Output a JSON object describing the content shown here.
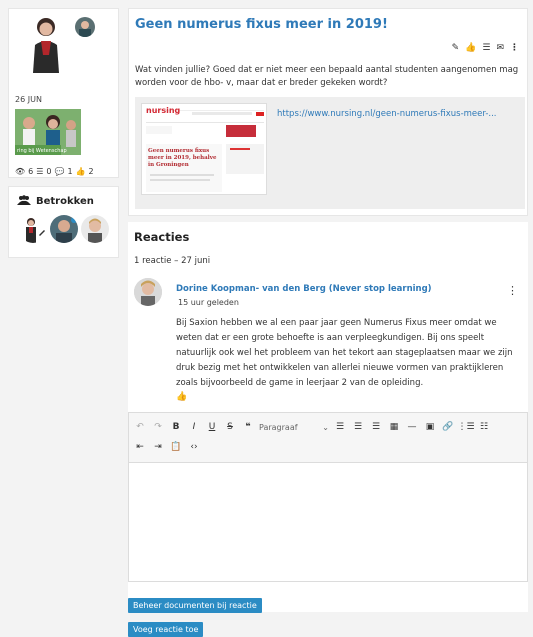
{
  "sidebar": {
    "date": "26 JUN",
    "thumb_caption": "ring bij Wetenschap",
    "stats": {
      "views": "6",
      "list": "0",
      "comments": "1",
      "likes": "2"
    },
    "involved_title": "Betrokken"
  },
  "post": {
    "title": "Geen numerus fixus meer in 2019!",
    "text": "Wat vinden jullie? Goed dat er niet meer een bepaald aantal studenten aangenomen mag worden voor de hbo- v, maar dat er breder gekeken wordt?",
    "link_url": "https://www.nursing.nl/geen-numerus-fixus-meer-...",
    "preview": {
      "brand": "nursing",
      "headline": "Geen numerus fixus meer in 2019, behalve in Groningen"
    }
  },
  "comments": {
    "title": "Reacties",
    "count_line": "1 reactie – 27 juni",
    "items": [
      {
        "author": "Dorine Koopman- van den Berg (Never stop learning)",
        "time": "15 uur geleden",
        "text": "Bij Saxion hebben we al een paar jaar geen Numerus Fixus meer omdat we weten dat er een grote behoefte is aan verpleegkundigen. Bij ons speelt natuurlijk ook wel het probleem van het tekort aan stageplaatsen maar we zijn druk bezig met het ontwikkelen van allerlei nieuwe vormen van praktijkleren zoals bijvoorbeeld de game in leerjaar 2 van de opleiding."
      }
    ]
  },
  "editor": {
    "format_select": "Paragraaf"
  },
  "buttons": {
    "manage_docs": "Beheer documenten bij reactie",
    "add_comment": "Voeg reactie toe"
  },
  "colors": {
    "link": "#2f7ab8",
    "button": "#2b8cc4"
  }
}
